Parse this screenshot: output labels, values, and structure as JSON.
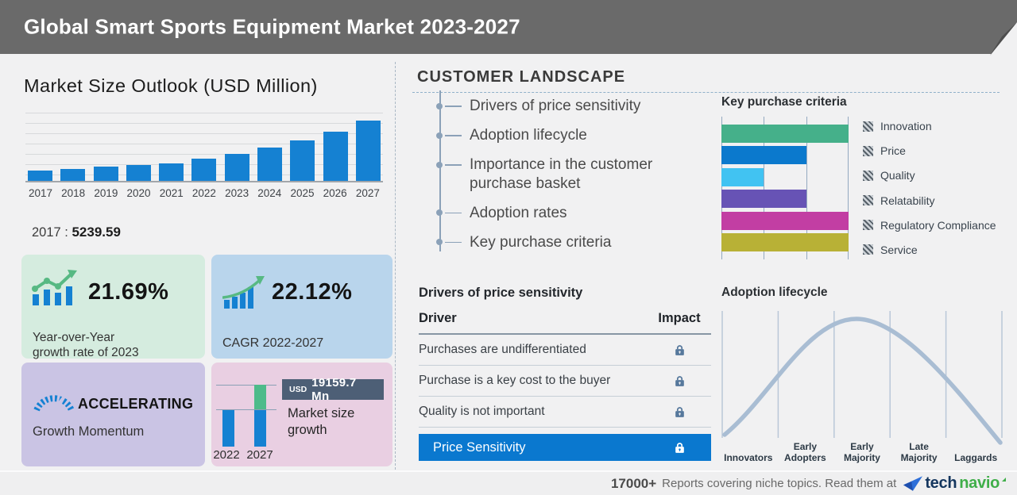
{
  "header": {
    "title": "Global Smart Sports Equipment Market 2023-2027"
  },
  "colors": {
    "bg": "#f1f1f2",
    "header-gray": "#6a6a6a",
    "accent-blue": "#1581d2",
    "highlight-row": "#0a78cf",
    "green": "#4dbb8a",
    "slate": "#4d5f76",
    "box-green": "#d5ecdf",
    "box-blue": "#b9d5ec",
    "box-purple": "#cac4e4",
    "box-pink": "#e9cfe2",
    "curve": "#a9bdd3",
    "rail": "#8ba1b8",
    "lock": "#56789c",
    "brand-navy": "#14365e",
    "brand-green": "#3fae49"
  },
  "market_outlook": {
    "base_year_label": "2017 :",
    "base_year_value": "5239.59",
    "stats": {
      "yoy": {
        "value": "21.69%",
        "label": "Year-over-Year\ngrowth rate of 2023"
      },
      "cagr": {
        "value": "22.12%",
        "label": "CAGR 2022-2027"
      },
      "momentum": {
        "value": "ACCELERATING",
        "label": "Growth Momentum"
      },
      "growth": {
        "currency": "USD",
        "amount": "19159.7 Mn",
        "label": "Market size\ngrowth",
        "years": [
          "2022",
          "2027"
        ]
      }
    }
  },
  "customer_landscape": {
    "title": "CUSTOMER LANDSCAPE",
    "items": [
      "Drivers of price sensitivity",
      "Adoption lifecycle",
      "Importance in the customer purchase basket",
      "Adoption rates",
      "Key purchase criteria"
    ],
    "price_sensitivity": {
      "title": "Drivers of price sensitivity",
      "columns": {
        "driver": "Driver",
        "impact": "Impact"
      },
      "rows": [
        "Purchases are undifferentiated",
        "Purchase is a key cost to the buyer",
        "Quality is not important"
      ],
      "highlight": "Price Sensitivity"
    }
  },
  "footer": {
    "reports_count": "17000+",
    "text": "Reports covering niche topics. Read them at",
    "brand": {
      "prefix": "tech",
      "suffix": "navio"
    }
  },
  "chart_data": [
    {
      "id": "market_size_outlook",
      "type": "bar",
      "title": "Market Size Outlook (USD Million)",
      "categories": [
        "2017",
        "2018",
        "2019",
        "2020",
        "2021",
        "2022",
        "2023",
        "2024",
        "2025",
        "2026",
        "2027"
      ],
      "values": [
        5239.59,
        6100,
        7100,
        7800,
        8900,
        11158.9,
        13579.3,
        16583,
        20252,
        24731,
        30318.6
      ],
      "ylabel": "USD Million",
      "ylim": [
        0,
        35000
      ],
      "grid": true,
      "bar_color": "#1581d2",
      "annotations": [
        "2017 : 5239.59"
      ],
      "notes": "2018-2021 values estimated from bar heights; 2022-2027 derived from stated CAGR 22.12%, YoY 21.69% and incremental growth USD 19159.7 Mn"
    },
    {
      "id": "key_purchase_criteria",
      "type": "bar",
      "orientation": "horizontal",
      "title": "Key purchase criteria",
      "categories": [
        "Innovation",
        "Price",
        "Quality",
        "Relatability",
        "Regulatory Compliance",
        "Service"
      ],
      "values": [
        3,
        2,
        1,
        2,
        3,
        3
      ],
      "xlim": [
        0,
        3
      ],
      "grid": true,
      "legend_position": "right",
      "colors": [
        "#45b08a",
        "#0b79cd",
        "#41c3f2",
        "#6753b5",
        "#c23ea3",
        "#b8b136"
      ],
      "notes": "relative bar lengths read from gridlines (scale 0-3)"
    },
    {
      "id": "market_size_growth",
      "type": "bar",
      "title": "Market size growth",
      "categories": [
        "2022",
        "2027"
      ],
      "values": [
        11158.9,
        30318.6
      ],
      "incremental_growth": "USD 19159.7 Mn",
      "colors": [
        "#1581d2",
        "#1581d2 + #4dbb8a (incremental segment)"
      ]
    },
    {
      "id": "adoption_lifecycle",
      "type": "area",
      "title": "Adoption lifecycle",
      "categories": [
        "Innovators",
        "Early Adopters",
        "Early Majority",
        "Late Majority",
        "Laggards"
      ],
      "description": "bell curve peaking at Early Majority",
      "grid": true
    }
  ]
}
